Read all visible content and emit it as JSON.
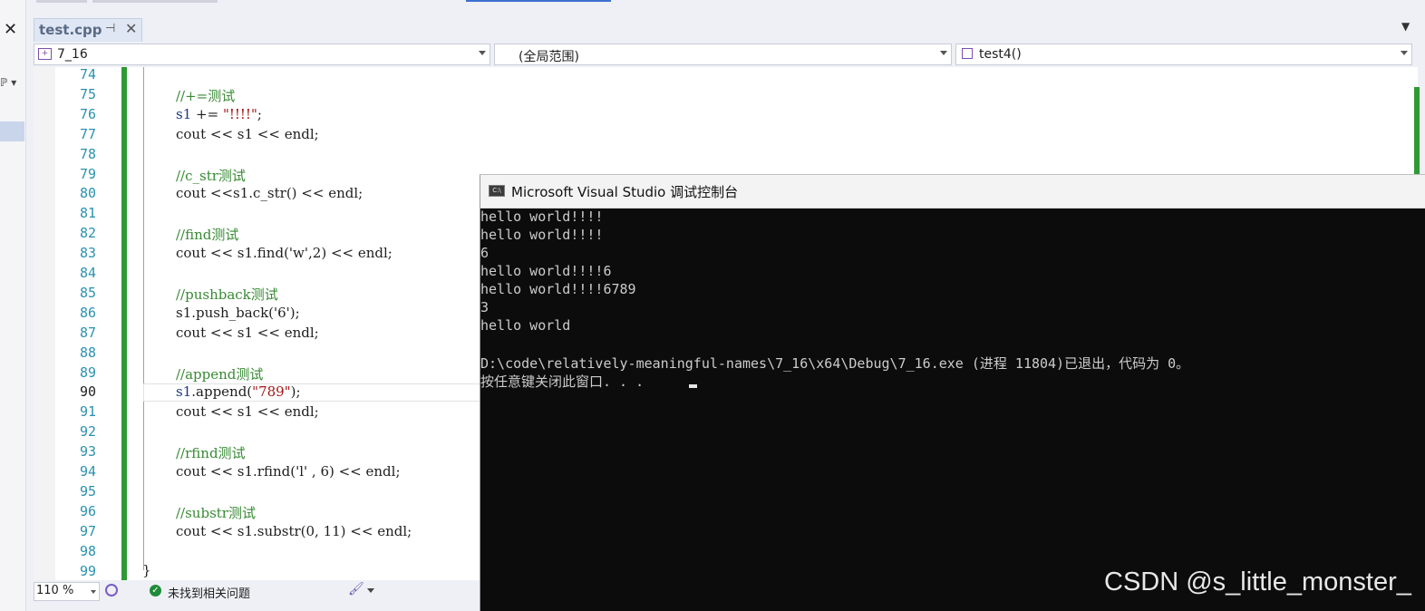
{
  "sidebar": {
    "close_glyph": "✕",
    "p_glyph": "ℙ ▾"
  },
  "tab": {
    "label": "test.cpp",
    "pin_glyph": "⊣",
    "close_glyph": "✕",
    "overflow_glyph": "▼"
  },
  "nav": {
    "project": "7_16",
    "scope": "(全局范围)",
    "function": "test4()"
  },
  "editor": {
    "current_line": 90,
    "lines": [
      {
        "n": "74"
      },
      {
        "n": "75",
        "comment": "//+=测试"
      },
      {
        "n": "76",
        "var": "s1",
        "op": " += ",
        "str": "\"!!!!\"",
        "rest": ";"
      },
      {
        "n": "77",
        "text": "cout << s1 << endl;"
      },
      {
        "n": "78"
      },
      {
        "n": "79",
        "comment": "//c_str测试"
      },
      {
        "n": "80",
        "text": "cout <<s1.c_str() << endl;"
      },
      {
        "n": "81"
      },
      {
        "n": "82",
        "comment": "//find测试"
      },
      {
        "n": "83",
        "text": "cout << s1.find('w',2) << endl;"
      },
      {
        "n": "84"
      },
      {
        "n": "85",
        "comment": "//pushback测试"
      },
      {
        "n": "86",
        "text": "s1.push_back('6');"
      },
      {
        "n": "87",
        "text": "cout << s1 << endl;"
      },
      {
        "n": "88"
      },
      {
        "n": "89",
        "comment": "//append测试"
      },
      {
        "n": "90",
        "var": "s1",
        "op": ".append(",
        "str": "\"789\"",
        "rest": ");"
      },
      {
        "n": "91",
        "text": "cout << s1 << endl;"
      },
      {
        "n": "92"
      },
      {
        "n": "93",
        "comment": "//rfind测试"
      },
      {
        "n": "94",
        "text": "cout << s1.rfind('l' , 6) << endl;"
      },
      {
        "n": "95"
      },
      {
        "n": "96",
        "comment": "//substr测试"
      },
      {
        "n": "97",
        "text": "cout << s1.substr(0, 11) << endl;"
      },
      {
        "n": "98"
      },
      {
        "n": "99"
      }
    ],
    "closing_brace": "}"
  },
  "status": {
    "zoom": "110 %",
    "issues": "未找到相关问题",
    "ok_glyph": "✓",
    "brush_glyph": "🖌"
  },
  "console": {
    "title": "Microsoft Visual Studio 调试控制台",
    "icon_text": "C:\\",
    "output": [
      "hello world!!!!",
      "hello world!!!!",
      "6",
      "hello world!!!!6",
      "hello world!!!!6789",
      "3",
      "hello world",
      "",
      "D:\\code\\relatively-meaningful-names\\7_16\\x64\\Debug\\7_16.exe (进程 11804)已退出，代码为 0。",
      "按任意键关闭此窗口. . ."
    ]
  },
  "watermark": "CSDN @s_little_monster_",
  "colors": {
    "line_number": "#2b91af",
    "comment": "#388a34",
    "string": "#a31515",
    "variable": "#1f377f",
    "change_bar": "#2e9a35",
    "console_bg": "#0c0c0c"
  }
}
